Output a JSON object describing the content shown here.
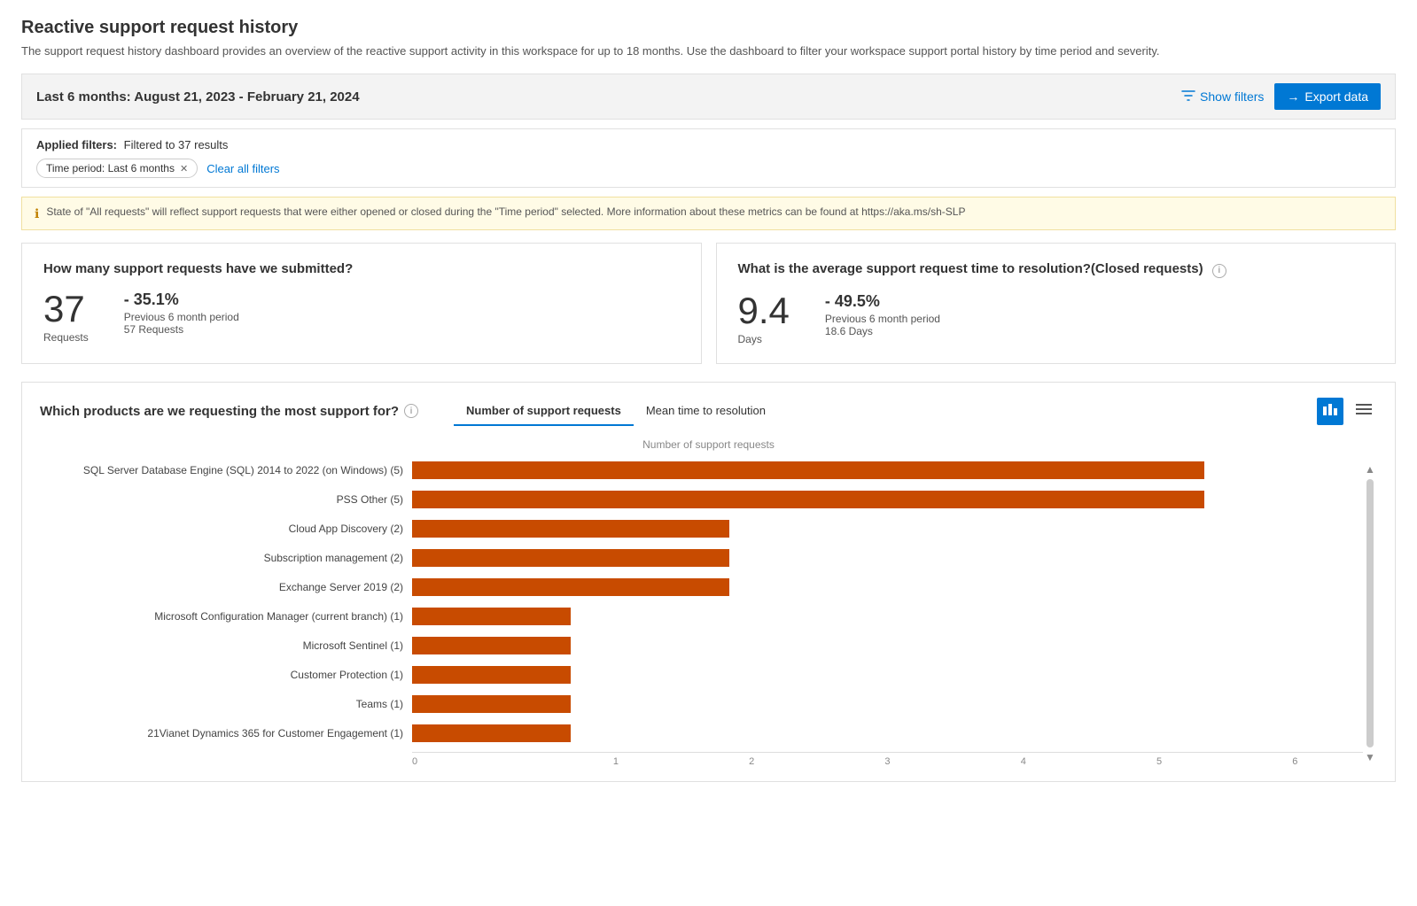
{
  "page": {
    "title": "Reactive support request history",
    "description": "The support request history dashboard provides an overview of the reactive support activity in this workspace for up to 18 months. Use the dashboard to filter your workspace support portal history by time period and severity."
  },
  "header_bar": {
    "title": "Last 6 months: August 21, 2023 - February 21, 2024",
    "show_filters_label": "Show filters",
    "export_label": "Export data"
  },
  "filter_bar": {
    "applied_label": "Applied filters:",
    "filter_text": "Filtered to 37 results",
    "tags": [
      {
        "label": "Time period: Last 6 months"
      }
    ],
    "clear_all_label": "Clear all filters"
  },
  "info_banner": {
    "text": "State of \"All requests\" will reflect support requests that were either opened or closed during the \"Time period\" selected. More information about these metrics can be found at https://aka.ms/sh-SLP"
  },
  "kpi_cards": [
    {
      "title": "How many support requests have we submitted?",
      "main_value": "37",
      "main_label": "Requests",
      "compare_pct": "- 35.1%",
      "compare_period": "Previous 6 month period",
      "compare_sub": "57 Requests"
    },
    {
      "title": "What is the average support request time to resolution?(Closed requests)",
      "main_value": "9.4",
      "main_label": "Days",
      "compare_pct": "- 49.5%",
      "compare_period": "Previous 6 month period",
      "compare_sub": "18.6 Days"
    }
  ],
  "chart_section": {
    "title": "Which products are we requesting the most support for?",
    "tabs": [
      {
        "label": "Number of support requests",
        "active": true
      },
      {
        "label": "Mean time to resolution",
        "active": false
      }
    ],
    "chart_title": "Number of support requests",
    "x_ticks": [
      "0",
      "1",
      "2",
      "3",
      "4",
      "5",
      "6"
    ],
    "max_value": 6,
    "bars": [
      {
        "label": "SQL Server  Database Engine (SQL)  2014 to 2022 (on Windows) (5)",
        "value": 5
      },
      {
        "label": "PSS Other (5)",
        "value": 5
      },
      {
        "label": "Cloud App Discovery (2)",
        "value": 2
      },
      {
        "label": "Subscription management (2)",
        "value": 2
      },
      {
        "label": "Exchange Server 2019 (2)",
        "value": 2
      },
      {
        "label": "Microsoft Configuration Manager (current branch) (1)",
        "value": 1
      },
      {
        "label": "Microsoft Sentinel (1)",
        "value": 1
      },
      {
        "label": "Customer Protection (1)",
        "value": 1
      },
      {
        "label": "Teams (1)",
        "value": 1
      },
      {
        "label": "21Vianet Dynamics 365 for Customer Engagement (1)",
        "value": 1
      }
    ]
  }
}
